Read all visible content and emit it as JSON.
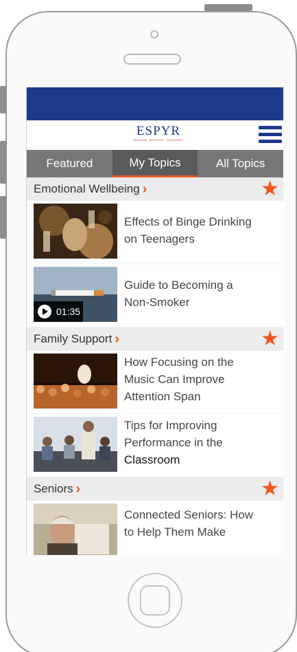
{
  "app": {
    "logo_text": "ESPYR",
    "logo_tagline": "IMAGINE. ACHIEVE. CONQUER."
  },
  "tabs": [
    {
      "label": "Featured",
      "active": false
    },
    {
      "label": "My Topics",
      "active": true
    },
    {
      "label": "All Topics",
      "active": false
    }
  ],
  "colors": {
    "brand_blue": "#1e3b8a",
    "accent_orange": "#f0561c",
    "tab_bg": "#777777",
    "tab_active_bg": "#5a5a5a"
  },
  "sections": [
    {
      "title": "Emotional Wellbeing",
      "items": [
        {
          "title_line1": "Effects of Binge Drinking",
          "title_line2": "on Teenagers",
          "title_line3": "",
          "thumb": "party-drinks-photo"
        },
        {
          "title_line1": "Guide to Becoming a",
          "title_line2": "Non-Smoker",
          "title_line3": "",
          "thumb": "cigarette-photo",
          "video_duration": "01:35"
        }
      ]
    },
    {
      "title": "Family Support",
      "items": [
        {
          "title_line1": "How Focusing on the",
          "title_line2": "Music Can Improve",
          "title_line3": "Attention Span",
          "thumb": "concert-crowd-photo"
        },
        {
          "title_line1": "Tips for Improving",
          "title_line2": "Performance in the",
          "title_line3": "Classroom",
          "thumb": "classroom-photo"
        }
      ]
    },
    {
      "title": "Seniors",
      "items": [
        {
          "title_line1": "Connected Seniors: How",
          "title_line2": "to Help Them Make",
          "title_line3": "",
          "thumb": "senior-man-photo"
        }
      ]
    }
  ],
  "icons": {
    "favorite": "star-icon",
    "section_link": "chevron-right-icon",
    "menu": "hamburger-menu-icon",
    "play": "play-icon"
  }
}
